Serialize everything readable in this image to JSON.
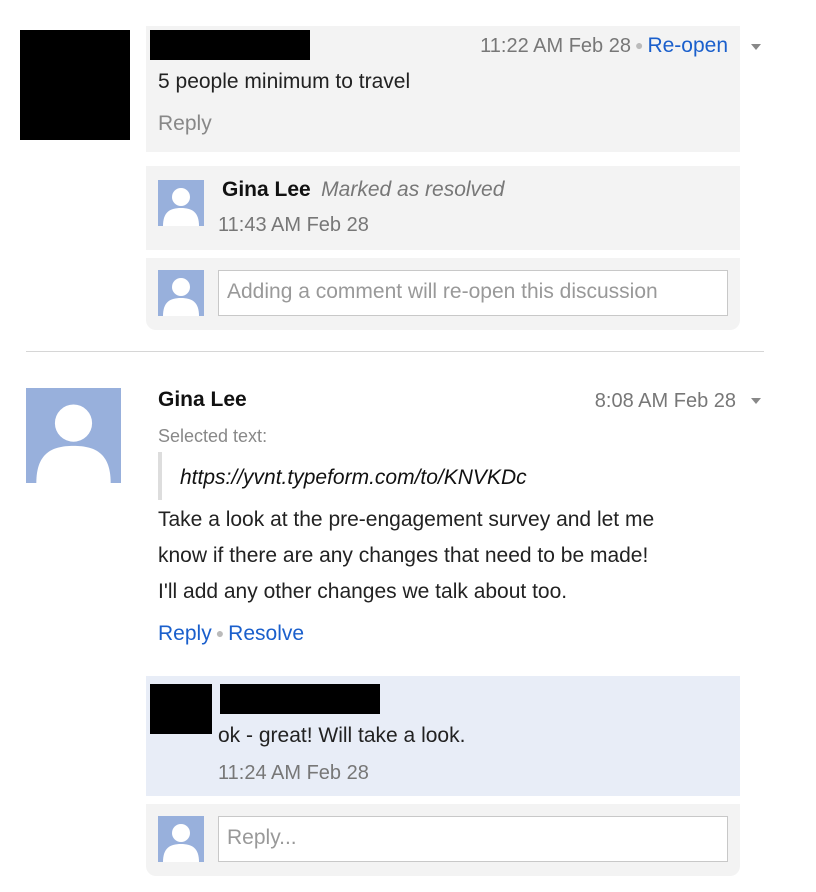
{
  "thread1": {
    "comment": {
      "timestamp": "11:22 AM Feb 28",
      "reopen_label": "Re-open",
      "text": "5 people minimum to travel",
      "reply_label": "Reply"
    },
    "resolution": {
      "author": "Gina Lee",
      "status": "Marked as resolved",
      "timestamp": "11:43 AM Feb 28"
    },
    "reply_input": {
      "placeholder": "Adding a comment will re-open this discussion"
    }
  },
  "thread2": {
    "comment": {
      "author": "Gina Lee",
      "timestamp": "8:08 AM Feb 28",
      "selected_label": "Selected text:",
      "selected_text": "https://yvnt.typeform.com/to/KNVKDc",
      "text_lines": [
        "Take a look at the pre-engagement survey and let me",
        "know if there are any changes that need to be made!",
        "I'll add any other changes we talk about too."
      ],
      "reply_label": "Reply",
      "resolve_label": "Resolve"
    },
    "reply": {
      "text": "ok - great! Will take a look.",
      "timestamp": "11:24 AM Feb 28"
    },
    "reply_input": {
      "placeholder": "Reply..."
    }
  },
  "colors": {
    "link": "#1a5fcc",
    "avatar": "#98b0dc",
    "highlight_bg": "#e8edf7",
    "panel_bg": "#f3f3f3"
  }
}
